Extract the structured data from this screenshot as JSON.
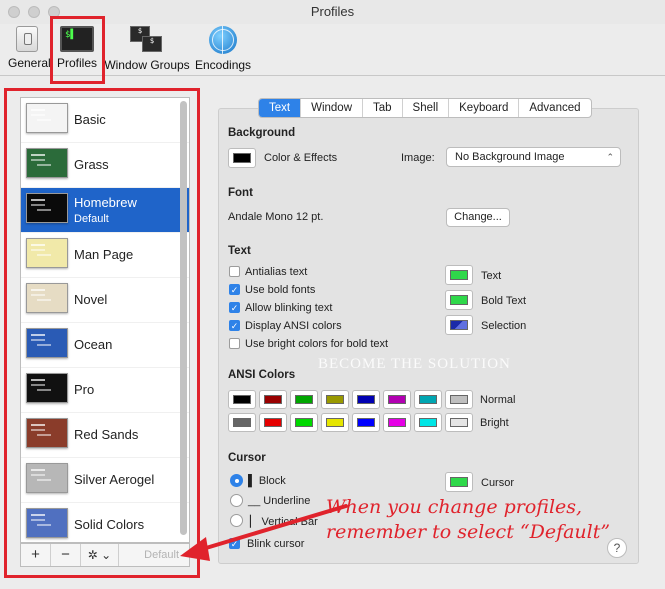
{
  "window": {
    "title": "Profiles"
  },
  "toolbar": {
    "items": [
      {
        "label": "General",
        "icon": "general-switch-icon"
      },
      {
        "label": "Profiles",
        "icon": "terminal-icon"
      },
      {
        "label": "Window Groups",
        "icon": "window-groups-icon"
      },
      {
        "label": "Encodings",
        "icon": "globe-icon"
      }
    ]
  },
  "profiles": [
    {
      "name": "Basic",
      "bg": "#f4f4f4"
    },
    {
      "name": "Grass",
      "bg": "#2b6b3a"
    },
    {
      "name": "Homebrew",
      "sub": "Default",
      "bg": "#0a0a0a",
      "selected": true
    },
    {
      "name": "Man Page",
      "bg": "#f1e9a9"
    },
    {
      "name": "Novel",
      "bg": "#e6dcc4"
    },
    {
      "name": "Ocean",
      "bg": "#2a5bb5"
    },
    {
      "name": "Pro",
      "bg": "#111111"
    },
    {
      "name": "Red Sands",
      "bg": "#8a3c2a"
    },
    {
      "name": "Silver Aerogel",
      "bg": "#b7b7b7"
    },
    {
      "name": "Solid Colors",
      "bg": "#5070c0"
    }
  ],
  "list_footer": {
    "add": "+",
    "remove": "−",
    "gear": "✲ ⌄",
    "default": "Default"
  },
  "tabs": [
    "Text",
    "Window",
    "Tab",
    "Shell",
    "Keyboard",
    "Advanced"
  ],
  "background": {
    "title": "Background",
    "color_effects": "Color & Effects",
    "image_label": "Image:",
    "image_value": "No Background Image"
  },
  "font": {
    "title": "Font",
    "value": "Andale Mono 12 pt.",
    "change": "Change..."
  },
  "text": {
    "title": "Text",
    "options": [
      {
        "label": "Antialias text",
        "checked": false
      },
      {
        "label": "Use bold fonts",
        "checked": true
      },
      {
        "label": "Allow blinking text",
        "checked": true
      },
      {
        "label": "Display ANSI colors",
        "checked": true
      },
      {
        "label": "Use bright colors for bold text",
        "checked": false
      }
    ],
    "colors": [
      {
        "label": "Text",
        "color": "#2fd84a"
      },
      {
        "label": "Bold Text",
        "color": "#2fd84a"
      },
      {
        "label": "Selection",
        "color": "#2b3cc8"
      }
    ]
  },
  "ansi": {
    "title": "ANSI Colors",
    "normal_label": "Normal",
    "bright_label": "Bright",
    "normal": [
      "#000000",
      "#990000",
      "#00a600",
      "#999900",
      "#0000b2",
      "#b200b2",
      "#00a6b2",
      "#bfbfbf"
    ],
    "bright": [
      "#666666",
      "#e50000",
      "#00d900",
      "#e5e500",
      "#0000ff",
      "#e500e5",
      "#00e5e5",
      "#e5e5e5"
    ]
  },
  "cursor": {
    "title": "Cursor",
    "block": "▌ Block",
    "underline": "__ Underline",
    "vertical": "▏ Vertical Bar",
    "blink": "Blink cursor",
    "color_label": "Cursor",
    "color": "#2fd84a"
  },
  "help": "?",
  "watermark": "BECOME THE SOLUTION",
  "annotation": {
    "line1": "When you change profiles,",
    "line2": "remember to select “Default”"
  },
  "accent": "#2e82e8",
  "highlight": "#e0232c"
}
